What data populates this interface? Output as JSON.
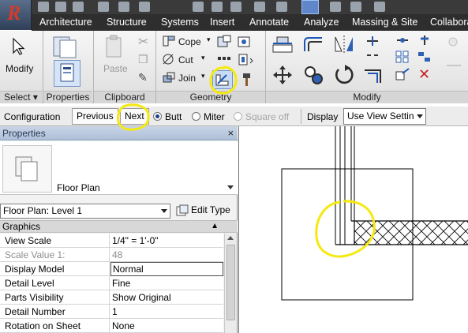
{
  "ribbon": {
    "tabs": [
      {
        "label": "Architecture"
      },
      {
        "label": "Structure"
      },
      {
        "label": "Systems"
      },
      {
        "label": "Insert"
      },
      {
        "label": "Annotate"
      },
      {
        "label": "Analyze"
      },
      {
        "label": "Massing & Site"
      },
      {
        "label": "Collabora"
      }
    ],
    "select": {
      "label": "Modify",
      "panel": "Select"
    },
    "properties_panel": "Properties",
    "clipboard": {
      "paste_label": "Paste",
      "panel": "Clipboard"
    },
    "geometry": {
      "cope_label": "Cope",
      "cut_label": "Cut",
      "join_label": "Join",
      "panel": "Geometry"
    },
    "modify_panel": "Modify"
  },
  "options_bar": {
    "context": "Configuration",
    "previous_label": "Previous",
    "next_label": "Next",
    "butt_label": "Butt",
    "miter_label": "Miter",
    "square_off_label": "Square off",
    "display_label": "Display",
    "display_value": "Use View Settin"
  },
  "properties": {
    "title": "Properties",
    "close_glyph": "×",
    "type_name": "Floor Plan",
    "instance_selector": "Floor Plan: Level 1",
    "edit_type_label": "Edit Type",
    "group": "Graphics",
    "rows": [
      {
        "name": "View Scale",
        "value": "1/4\" = 1'-0\""
      },
      {
        "name": "Scale Value    1:",
        "value": "48"
      },
      {
        "name": "Display Model",
        "value": "Normal"
      },
      {
        "name": "Detail Level",
        "value": "Fine"
      },
      {
        "name": "Parts Visibility",
        "value": "Show Original"
      },
      {
        "name": "Detail Number",
        "value": "1"
      },
      {
        "name": "Rotation on Sheet",
        "value": "None"
      }
    ]
  },
  "colors": {
    "annotation_highlight": "#f5e90f",
    "tab_bar": "#2e2e2e",
    "palette_title": "#aebfd8"
  },
  "icons": {
    "app": "revit-app-icon",
    "modify": "modify-arrow-icon",
    "paste": "paste-icon",
    "cope": "cope-icon",
    "cut": "cut-icon",
    "join": "join-icon",
    "wall_joins": "wall-joins-icon",
    "move": "move-icon",
    "rotate": "rotate-icon",
    "close": "close-icon"
  }
}
